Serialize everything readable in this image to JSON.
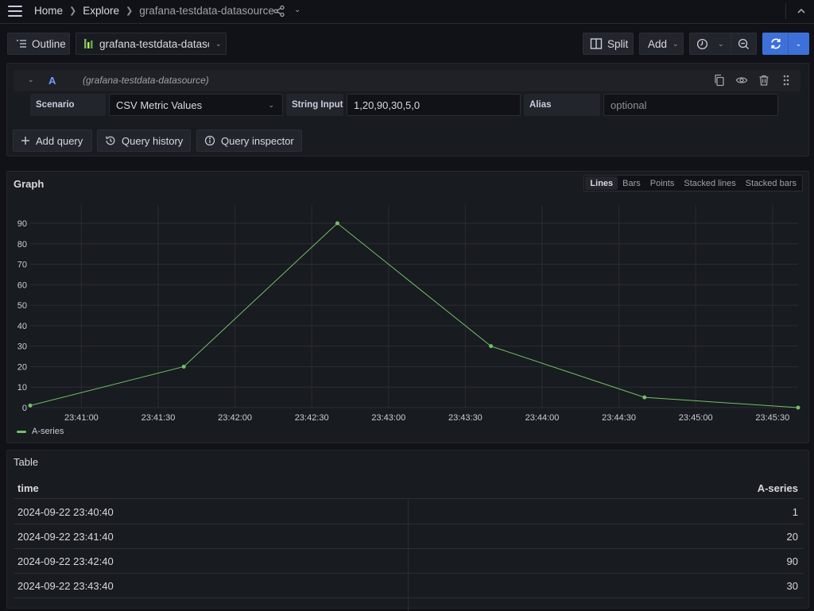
{
  "topbar": {
    "breadcrumb": [
      "Home",
      "Explore",
      "grafana-testdata-datasource"
    ],
    "icons": [
      "menu-icon",
      "share-icon",
      "chevron-down-icon",
      "chevron-up-icon"
    ]
  },
  "toolbar": {
    "outline_label": "Outline",
    "datasource_label": "grafana-testdata-datasc",
    "split_label": "Split",
    "add_label": "Add",
    "colors": {
      "run_button": "#3d71d9"
    }
  },
  "query": {
    "ref_id": "A",
    "datasource": "(grafana-testdata-datasource)",
    "scenario_label": "Scenario",
    "scenario_value": "CSV Metric Values",
    "string_input_label": "String Input",
    "string_input_value": "1,20,90,30,5,0",
    "alias_label": "Alias",
    "alias_placeholder": "optional",
    "buttons": {
      "add_query": "Add query",
      "query_history": "Query history",
      "query_inspector": "Query inspector"
    }
  },
  "graph": {
    "title": "Graph",
    "view_options": [
      {
        "label": "Lines",
        "active": true
      },
      {
        "label": "Bars",
        "active": false
      },
      {
        "label": "Points",
        "active": false
      },
      {
        "label": "Stacked lines",
        "active": false
      },
      {
        "label": "Stacked bars",
        "active": false
      }
    ]
  },
  "chart_data": {
    "type": "line",
    "title": "Graph",
    "xlabel": "",
    "ylabel": "",
    "x_ticks": [
      "23:41:00",
      "23:41:30",
      "23:42:00",
      "23:42:30",
      "23:43:00",
      "23:43:30",
      "23:44:00",
      "23:44:30",
      "23:45:00",
      "23:45:30"
    ],
    "x_tick_seconds": [
      20,
      50,
      80,
      110,
      140,
      170,
      200,
      230,
      260,
      290
    ],
    "x_range_seconds": [
      0,
      300
    ],
    "x_origin": "23:40:40",
    "y_ticks": [
      0,
      10,
      20,
      30,
      40,
      50,
      60,
      70,
      80,
      90
    ],
    "ylim": [
      0,
      90
    ],
    "grid": true,
    "legend_position": "bottom-left",
    "series": [
      {
        "name": "A-series",
        "color": "#73bf69",
        "x": [
          "23:40:40",
          "23:41:40",
          "23:42:40",
          "23:43:40",
          "23:44:40",
          "23:45:40"
        ],
        "x_seconds": [
          0,
          60,
          120,
          180,
          240,
          300
        ],
        "values": [
          1,
          20,
          90,
          30,
          5,
          0
        ]
      }
    ]
  },
  "table": {
    "title": "Table",
    "columns": [
      "time",
      "A-series"
    ],
    "rows": [
      [
        "2024-09-22 23:40:40",
        "1"
      ],
      [
        "2024-09-22 23:41:40",
        "20"
      ],
      [
        "2024-09-22 23:42:40",
        "90"
      ],
      [
        "2024-09-22 23:43:40",
        "30"
      ]
    ]
  }
}
